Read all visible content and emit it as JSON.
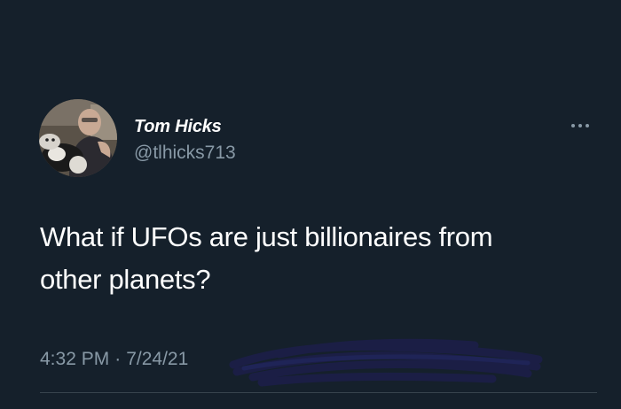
{
  "tweet": {
    "author": {
      "display_name": "Tom Hicks",
      "handle": "@tlhicks713",
      "avatar_icon": "profile-photo"
    },
    "text_line1": "What if UFOs are just billionaires from",
    "text_line2": "other planets?",
    "time": "4:32 PM",
    "separator": "·",
    "date": "7/24/21",
    "more_icon": "more-options-icon"
  },
  "theme": {
    "background": "#15202b",
    "primary_text": "#ffffff",
    "secondary_text": "#8899a6",
    "divider": "#38444d",
    "redaction_scribble": "#1c1f4a"
  }
}
